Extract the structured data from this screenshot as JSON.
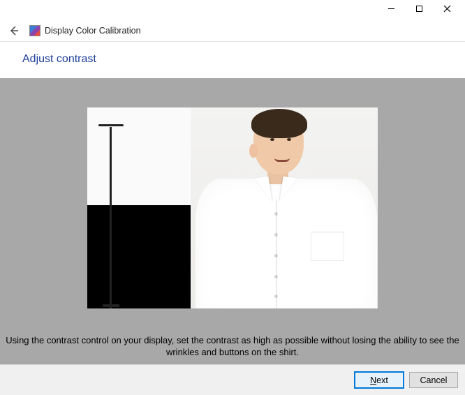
{
  "window": {
    "title": "Display Color Calibration"
  },
  "page": {
    "heading": "Adjust contrast",
    "instruction": "Using the contrast control on your display, set the contrast as high as possible without losing the ability to see the wrinkles and buttons on the shirt."
  },
  "buttons": {
    "next": "Next",
    "cancel": "Cancel"
  }
}
